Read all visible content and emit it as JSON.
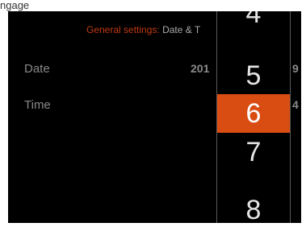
{
  "window": {
    "top_fragment": "ngage"
  },
  "breadcrumb": {
    "parent": "General settings:",
    "current": "Date & T"
  },
  "settings": {
    "rows": [
      {
        "label": "Date",
        "value_left": "201",
        "value_right": "9"
      },
      {
        "label": "Time",
        "value_right": "4"
      }
    ]
  },
  "picker": {
    "items": [
      "4",
      "5",
      "6",
      "7",
      "8"
    ],
    "selected": "6"
  },
  "colors": {
    "accent": "#d94c12",
    "breadcrumb_parent": "#c13a12",
    "background": "#000000"
  }
}
